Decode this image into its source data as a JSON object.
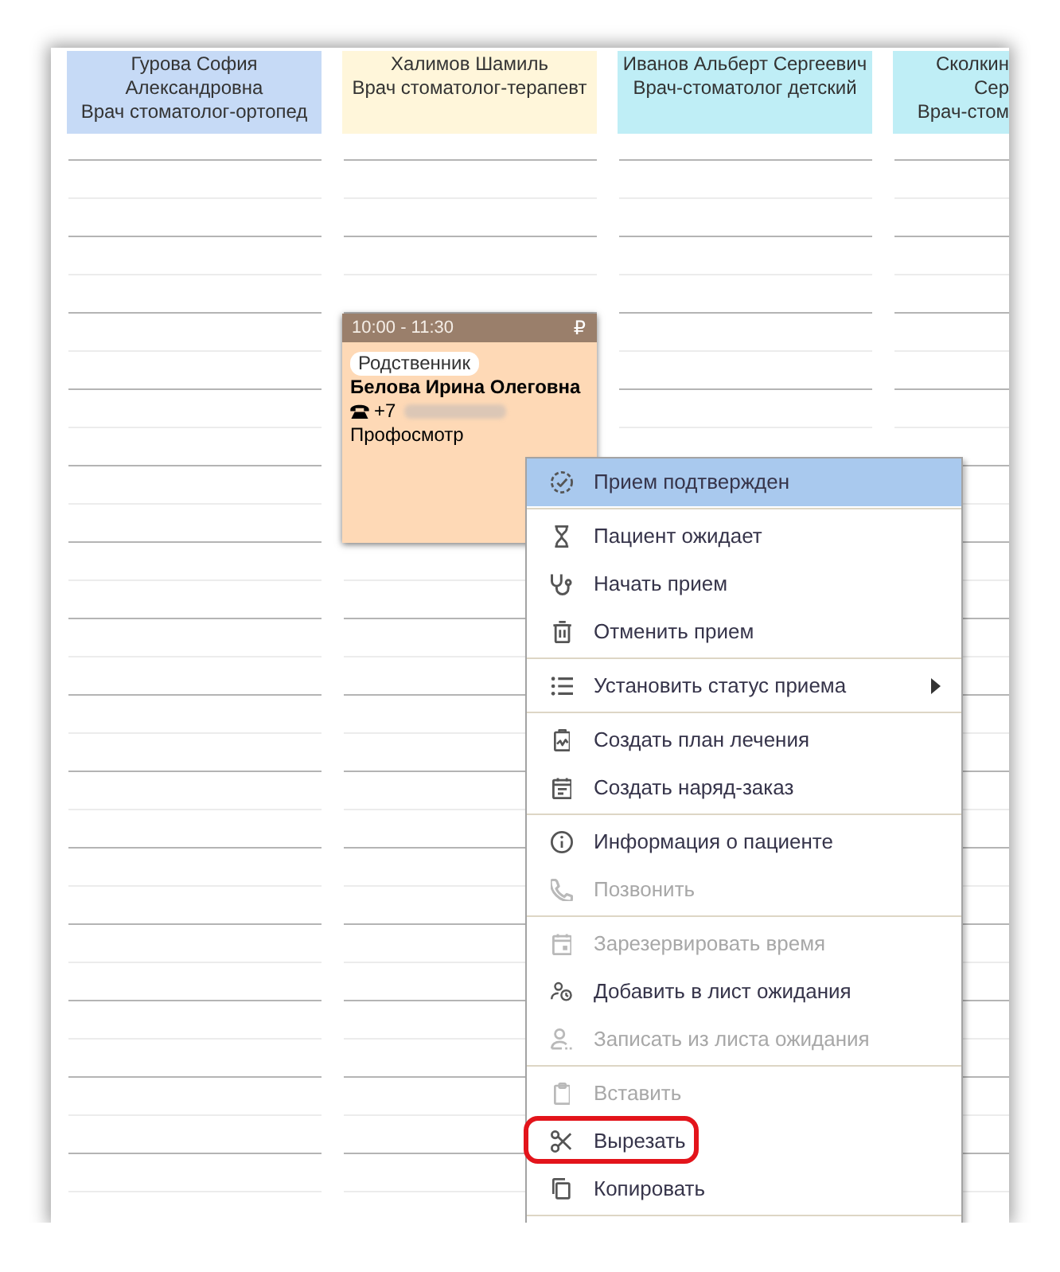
{
  "doctors": [
    {
      "name": "Гурова София Александровна",
      "specialty": "Врач стоматолог-ортопед",
      "color": "#c6daf6"
    },
    {
      "name": "Халимов Шамиль",
      "specialty": "Врач стоматолог-терапевт",
      "color": "#fff6da",
      "appointments": [
        {
          "time": "10:00 - 11:30",
          "payment_sign": "₽",
          "tag": "Родственник",
          "patient": "Белова Ирина Олеговна",
          "phone": "+7",
          "phone_redacted": true,
          "service": "Профосмотр"
        }
      ]
    },
    {
      "name": "Иванов Альберт Сергеевич",
      "specialty": "Врач-стоматолог детский",
      "color": "#bfeef6"
    },
    {
      "name": "Сколкин Сер",
      "specialty": "Врач-стом",
      "color": "#bfeef6"
    }
  ],
  "context_menu": {
    "groups": [
      [
        {
          "label": "Прием подтвержден",
          "selected": true,
          "disabled": false,
          "submenu": false,
          "annotated": false
        }
      ],
      [
        {
          "label": "Пациент ожидает",
          "selected": false,
          "disabled": false,
          "submenu": false,
          "annotated": false
        },
        {
          "label": "Начать прием",
          "selected": false,
          "disabled": false,
          "submenu": false,
          "annotated": false
        },
        {
          "label": "Отменить прием",
          "selected": false,
          "disabled": false,
          "submenu": false,
          "annotated": false
        }
      ],
      [
        {
          "label": "Установить статус приема",
          "selected": false,
          "disabled": false,
          "submenu": true,
          "annotated": false
        }
      ],
      [
        {
          "label": "Создать план лечения",
          "selected": false,
          "disabled": false,
          "submenu": false,
          "annotated": false
        },
        {
          "label": "Создать наряд-заказ",
          "selected": false,
          "disabled": false,
          "submenu": false,
          "annotated": false
        }
      ],
      [
        {
          "label": "Информация о пациенте",
          "selected": false,
          "disabled": false,
          "submenu": false,
          "annotated": false
        },
        {
          "label": "Позвонить",
          "selected": false,
          "disabled": true,
          "submenu": false,
          "annotated": false
        }
      ],
      [
        {
          "label": "Зарезервировать время",
          "selected": false,
          "disabled": true,
          "submenu": false,
          "annotated": false
        },
        {
          "label": "Добавить в лист ожидания",
          "selected": false,
          "disabled": false,
          "submenu": false,
          "annotated": false
        },
        {
          "label": "Записать из листа ожидания",
          "selected": false,
          "disabled": true,
          "submenu": false,
          "annotated": false
        }
      ],
      [
        {
          "label": "Вставить",
          "selected": false,
          "disabled": true,
          "submenu": false,
          "annotated": false
        },
        {
          "label": "Вырезать",
          "selected": false,
          "disabled": false,
          "submenu": false,
          "annotated": true
        },
        {
          "label": "Копировать",
          "selected": false,
          "disabled": false,
          "submenu": false,
          "annotated": false
        }
      ]
    ]
  }
}
